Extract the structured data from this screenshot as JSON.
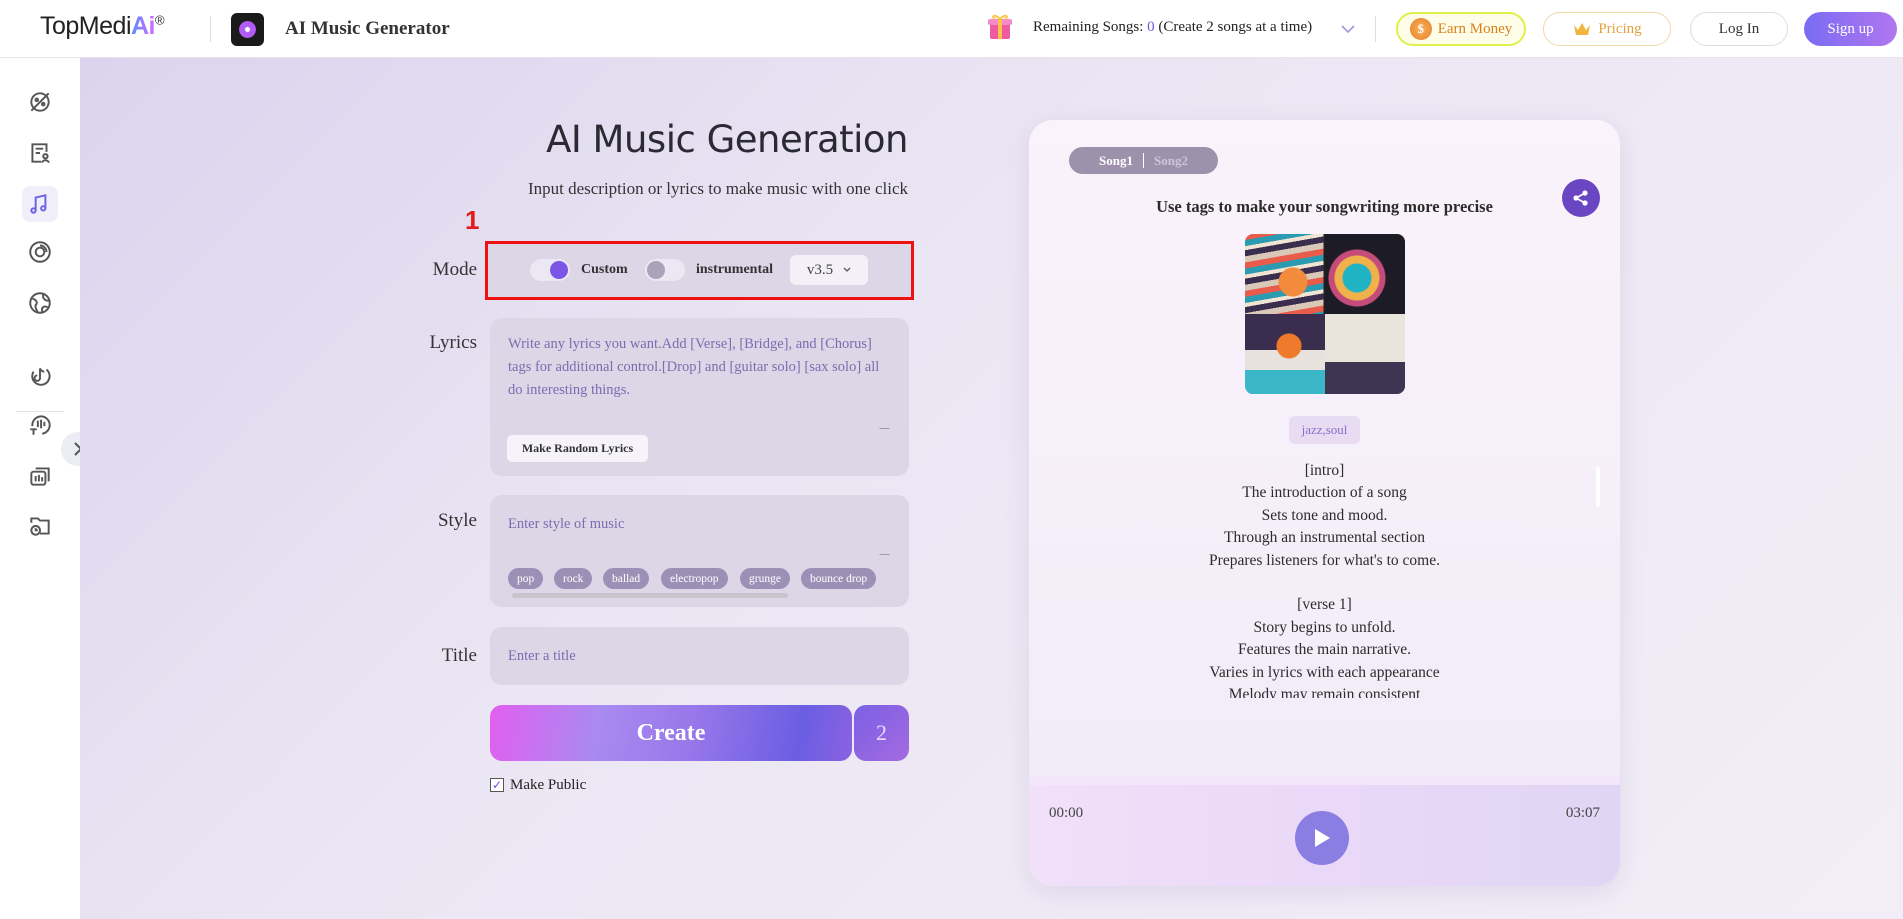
{
  "header": {
    "logo_text": "TopMedi",
    "logo_ai": "Ai",
    "logo_reg": "®",
    "app_title": "AI Music Generator",
    "remaining_label": "Remaining Songs: ",
    "remaining_count": "0",
    "remaining_note": " (Create 2 songs at a time)",
    "earn_money": "Earn Money",
    "earn_coin": "$",
    "pricing": "Pricing",
    "login": "Log In",
    "signup": "Sign up"
  },
  "sidebar": {
    "items": [
      {
        "icon": "planet-icon"
      },
      {
        "icon": "lyrics-profile-icon"
      },
      {
        "icon": "music-note-icon",
        "active": true
      },
      {
        "icon": "vinyl-disc-icon"
      },
      {
        "icon": "globe-icon"
      },
      {
        "icon": "tiktok-icon"
      },
      {
        "icon": "voice-chat-icon"
      },
      {
        "icon": "audio-layers-icon"
      },
      {
        "icon": "folder-clock-icon"
      }
    ]
  },
  "main": {
    "title": "AI Music Generation",
    "subtitle": "Input description or lyrics to make music with one click",
    "annotation": "1",
    "mode": {
      "label": "Mode",
      "custom_label": "Custom",
      "custom_on": true,
      "instrumental_label": "instrumental",
      "instrumental_on": false,
      "version": "v3.5"
    },
    "lyrics": {
      "label": "Lyrics",
      "placeholder": "Write any lyrics you want.Add [Verse], [Bridge], and [Chorus] tags for additional control.[Drop] and [guitar solo] [sax solo] all do interesting things.",
      "random_button": "Make Random Lyrics"
    },
    "style": {
      "label": "Style",
      "placeholder": "Enter style of music",
      "chips": [
        "pop",
        "rock",
        "ballad",
        "electropop",
        "grunge",
        "bounce drop"
      ]
    },
    "title_field": {
      "label": "Title",
      "placeholder": "Enter a title"
    },
    "create_label": "Create",
    "create_count": "2",
    "make_public_label": "Make Public",
    "make_public_checked": true
  },
  "card": {
    "tabs": [
      "Song1",
      "Song2"
    ],
    "active_tab": "Song1",
    "heading": "Use tags to make your songwriting more precise",
    "tag": "jazz,soul",
    "lyrics": [
      "[intro]",
      "The introduction of a song",
      "Sets tone and mood.",
      "Through an instrumental section",
      "Prepares listeners for what's to come.",
      "",
      "[verse 1]",
      "Story begins to unfold.",
      "Features the main narrative.",
      "Varies in lyrics with each appearance",
      "Melody may remain consistent"
    ],
    "time_current": "00:00",
    "time_total": "03:07"
  },
  "colors": {
    "accent": "#6b63e8",
    "highlight_box": "#ee1111",
    "signup": "#7a6cf2",
    "share": "#6a46c3",
    "play": "#8b7ee3"
  }
}
